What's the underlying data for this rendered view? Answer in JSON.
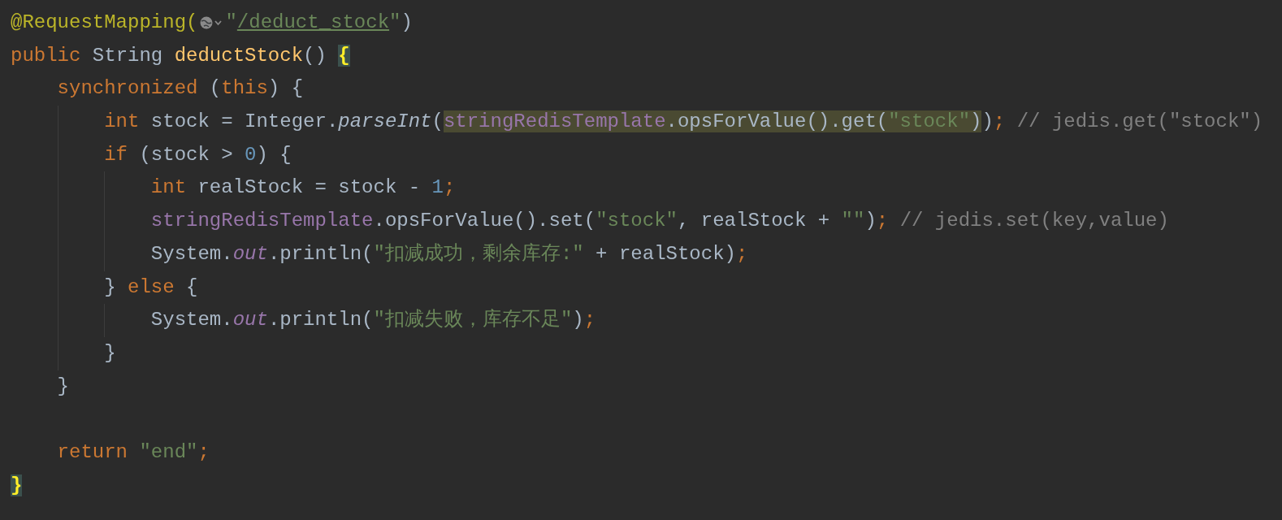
{
  "lines": [
    {
      "groups": [
        [
          {
            "text": "@RequestMapping(",
            "kind": "annotation"
          }
        ],
        [
          {
            "text": "\"",
            "kind": "string"
          },
          {
            "text": "/deduct_stock",
            "kind": "url"
          },
          {
            "text": "\"",
            "kind": "string"
          },
          {
            "text": ")",
            "kind": "plain"
          }
        ]
      ],
      "url_icon": true
    },
    {
      "groups": [
        [
          {
            "text": "public",
            "kind": "keyword"
          },
          {
            "text": " String ",
            "kind": "plain"
          },
          {
            "text": "deductStock",
            "kind": "method-decl"
          },
          {
            "text": "() ",
            "kind": "plain"
          },
          {
            "text": "{",
            "kind": "brace",
            "highlighted": true
          }
        ]
      ]
    },
    {
      "groups": [
        [
          {
            "text": "    synchronized",
            "kind": "keyword"
          },
          {
            "text": " (",
            "kind": "plain"
          },
          {
            "text": "this",
            "kind": "keyword"
          },
          {
            "text": ") {",
            "kind": "plain"
          }
        ]
      ]
    },
    {
      "groups": [
        [
          {
            "text": "        int",
            "kind": "keyword"
          },
          {
            "text": " stock = Integer.",
            "kind": "plain"
          },
          {
            "text": "parseInt",
            "kind": "static-method"
          },
          {
            "text": "(",
            "kind": "plain"
          },
          {
            "text": "stringRedisTemplate",
            "kind": "field",
            "highlighted": true
          },
          {
            "text": ".opsForValue().get(",
            "kind": "plain",
            "highlighted": true
          },
          {
            "text": "\"stock\"",
            "kind": "string",
            "highlighted": true
          },
          {
            "text": ")",
            "kind": "plain",
            "highlighted": true
          },
          {
            "text": ")",
            "kind": "plain"
          },
          {
            "text": ";",
            "kind": "keyword"
          },
          {
            "text": " // jedis.get(\"stock\")",
            "kind": "comment"
          }
        ]
      ]
    },
    {
      "groups": [
        [
          {
            "text": "        if",
            "kind": "keyword"
          },
          {
            "text": " (stock > ",
            "kind": "plain"
          },
          {
            "text": "0",
            "kind": "number"
          },
          {
            "text": ") {",
            "kind": "plain"
          }
        ]
      ]
    },
    {
      "groups": [
        [
          {
            "text": "            int",
            "kind": "keyword"
          },
          {
            "text": " realStock = stock - ",
            "kind": "plain"
          },
          {
            "text": "1",
            "kind": "number"
          },
          {
            "text": ";",
            "kind": "keyword"
          }
        ]
      ]
    },
    {
      "groups": [
        [
          {
            "text": "            stringRedisTemplate",
            "kind": "field"
          },
          {
            "text": ".opsForValue().set(",
            "kind": "plain"
          },
          {
            "text": "\"stock\"",
            "kind": "string"
          },
          {
            "text": ", realStock + ",
            "kind": "plain"
          },
          {
            "text": "\"\"",
            "kind": "string"
          },
          {
            "text": ")",
            "kind": "plain"
          },
          {
            "text": ";",
            "kind": "keyword"
          },
          {
            "text": " // jedis.set(key,value)",
            "kind": "comment"
          }
        ]
      ]
    },
    {
      "groups": [
        [
          {
            "text": "            System.",
            "kind": "plain"
          },
          {
            "text": "out",
            "kind": "static-field"
          },
          {
            "text": ".println(",
            "kind": "plain"
          },
          {
            "text": "\"扣减成功，剩余库存:\"",
            "kind": "string"
          },
          {
            "text": " + realStock)",
            "kind": "plain"
          },
          {
            "text": ";",
            "kind": "keyword"
          }
        ]
      ]
    },
    {
      "groups": [
        [
          {
            "text": "        } ",
            "kind": "plain"
          },
          {
            "text": "else",
            "kind": "keyword"
          },
          {
            "text": " {",
            "kind": "plain"
          }
        ]
      ]
    },
    {
      "groups": [
        [
          {
            "text": "            System.",
            "kind": "plain"
          },
          {
            "text": "out",
            "kind": "static-field"
          },
          {
            "text": ".println(",
            "kind": "plain"
          },
          {
            "text": "\"扣减失败，库存不足\"",
            "kind": "string"
          },
          {
            "text": ")",
            "kind": "plain"
          },
          {
            "text": ";",
            "kind": "keyword"
          }
        ]
      ]
    },
    {
      "groups": [
        [
          {
            "text": "        }",
            "kind": "plain"
          }
        ]
      ]
    },
    {
      "groups": [
        [
          {
            "text": "    }",
            "kind": "plain"
          }
        ]
      ]
    },
    {
      "blank": true
    },
    {
      "groups": [
        [
          {
            "text": "    return ",
            "kind": "keyword"
          },
          {
            "text": "\"end\"",
            "kind": "string"
          },
          {
            "text": ";",
            "kind": "keyword"
          }
        ]
      ]
    },
    {
      "groups": [
        [
          {
            "text": "}",
            "kind": "brace",
            "highlighted": true
          }
        ]
      ]
    }
  ]
}
